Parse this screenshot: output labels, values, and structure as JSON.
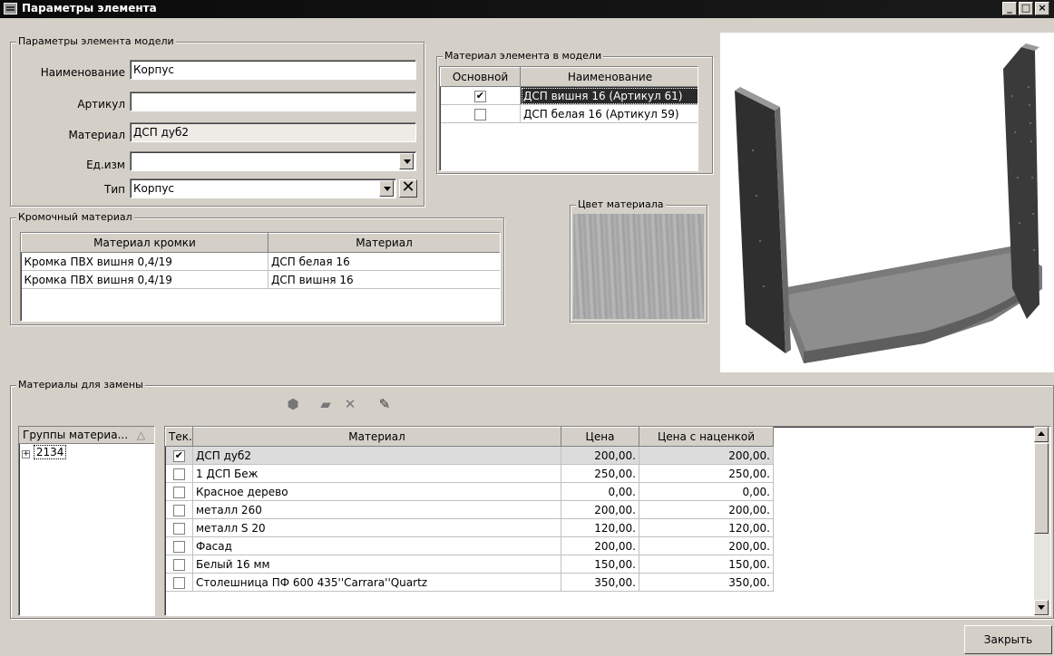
{
  "window": {
    "title": "Параметры элемента"
  },
  "params": {
    "group_label": "Параметры элемента модели",
    "name_label": "Наименование",
    "name_value": "Корпус",
    "article_label": "Артикул",
    "article_value": "",
    "material_label": "Материал",
    "material_value": "ДСП дуб2",
    "unit_label": "Ед.изм",
    "unit_value": "",
    "type_label": "Тип",
    "type_value": "Корпус"
  },
  "model_material": {
    "group_label": "Материал элемента в модели",
    "headers": [
      "Основной",
      "Наименование"
    ],
    "rows": [
      {
        "checked": true,
        "name": "ДСП вишня 16 (Артикул 61)"
      },
      {
        "checked": false,
        "name": "ДСП белая 16 (Артикул 59)"
      }
    ]
  },
  "edge": {
    "group_label": "Кромочный материал",
    "headers": [
      "Материал кромки",
      "Материал"
    ],
    "rows": [
      [
        "Кромка ПВХ вишня 0,4/19",
        "ДСП белая 16"
      ],
      [
        "Кромка ПВХ вишня 0,4/19",
        "ДСП вишня 16"
      ]
    ]
  },
  "color": {
    "group_label": "Цвет материала"
  },
  "replace": {
    "group_label": "Материалы для замены",
    "groups_header": "Группы материа...",
    "tree_item": "2134",
    "headers": [
      "Тек.",
      "Материал",
      "Цена",
      "Цена с наценкой"
    ],
    "rows": [
      {
        "checked": true,
        "name": "ДСП дуб2",
        "price": "200,00.",
        "price2": "200,00."
      },
      {
        "checked": false,
        "name": "1 ДСП Беж",
        "price": "250,00.",
        "price2": "250,00."
      },
      {
        "checked": false,
        "name": "Красное дерево",
        "price": "0,00.",
        "price2": "0,00."
      },
      {
        "checked": false,
        "name": "металл 260",
        "price": "200,00.",
        "price2": "200,00."
      },
      {
        "checked": false,
        "name": "металл S 20",
        "price": "120,00.",
        "price2": "120,00."
      },
      {
        "checked": false,
        "name": "Фасад",
        "price": "200,00.",
        "price2": "200,00."
      },
      {
        "checked": false,
        "name": "Белый 16 мм",
        "price": "150,00.",
        "price2": "150,00."
      },
      {
        "checked": false,
        "name": "Столешница ПФ 600 435''Carrara''Quartz",
        "price": "350,00.",
        "price2": "350,00."
      }
    ]
  },
  "buttons": {
    "close": "Закрыть"
  }
}
